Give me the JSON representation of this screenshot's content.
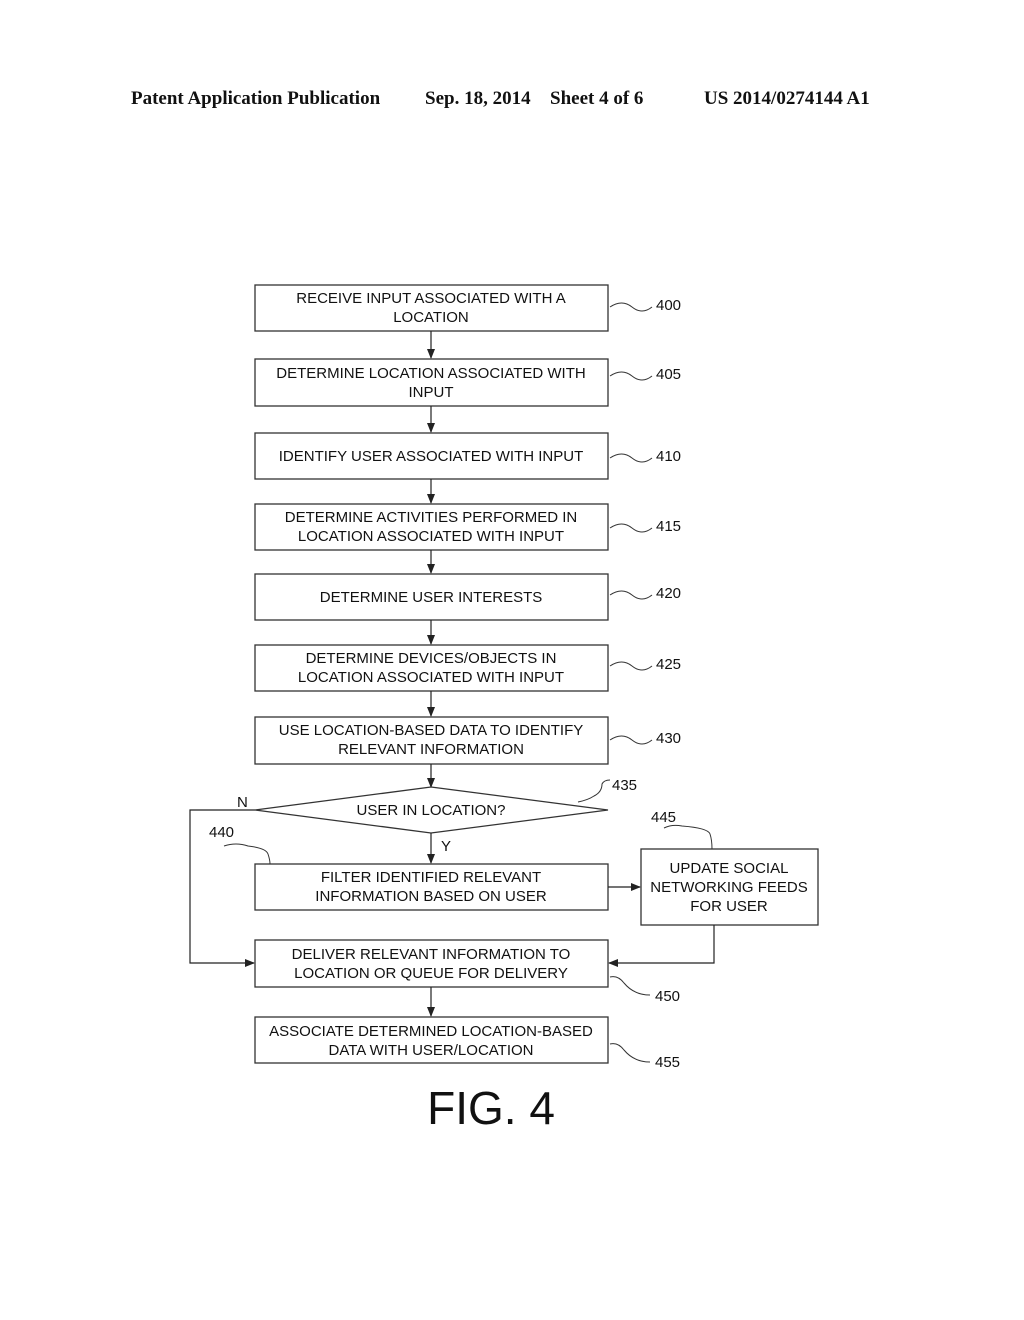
{
  "header": {
    "publication": "Patent Application Publication",
    "date": "Sep. 18, 2014",
    "sheet": "Sheet 4 of 6",
    "number": "US 2014/0274144 A1"
  },
  "figure": {
    "label": "FIG. 4",
    "steps": [
      {
        "ref": "400",
        "lines": [
          "RECEIVE INPUT ASSOCIATED WITH A",
          "LOCATION"
        ]
      },
      {
        "ref": "405",
        "lines": [
          "DETERMINE LOCATION ASSOCIATED WITH",
          "INPUT"
        ]
      },
      {
        "ref": "410",
        "lines": [
          "IDENTIFY USER ASSOCIATED WITH INPUT"
        ]
      },
      {
        "ref": "415",
        "lines": [
          "DETERMINE ACTIVITIES PERFORMED IN",
          "LOCATION ASSOCIATED WITH INPUT"
        ]
      },
      {
        "ref": "420",
        "lines": [
          "DETERMINE USER INTERESTS"
        ]
      },
      {
        "ref": "425",
        "lines": [
          "DETERMINE DEVICES/OBJECTS IN",
          "LOCATION ASSOCIATED WITH INPUT"
        ]
      },
      {
        "ref": "430",
        "lines": [
          "USE LOCATION-BASED DATA TO IDENTIFY",
          "RELEVANT INFORMATION"
        ]
      }
    ],
    "decision": {
      "ref": "435",
      "text": "USER IN LOCATION?",
      "no_label": "N",
      "yes_label": "Y"
    },
    "filter": {
      "ref": "440",
      "lines": [
        "FILTER IDENTIFIED RELEVANT",
        "INFORMATION BASED ON USER"
      ]
    },
    "social": {
      "ref": "445",
      "lines": [
        "UPDATE SOCIAL",
        "NETWORKING FEEDS",
        "FOR USER"
      ]
    },
    "deliver": {
      "ref": "450",
      "lines": [
        "DELIVER RELEVANT INFORMATION TO",
        "LOCATION OR QUEUE FOR DELIVERY"
      ]
    },
    "associate": {
      "ref": "455",
      "lines": [
        "ASSOCIATE DETERMINED LOCATION-BASED",
        "DATA WITH USER/LOCATION"
      ]
    }
  }
}
